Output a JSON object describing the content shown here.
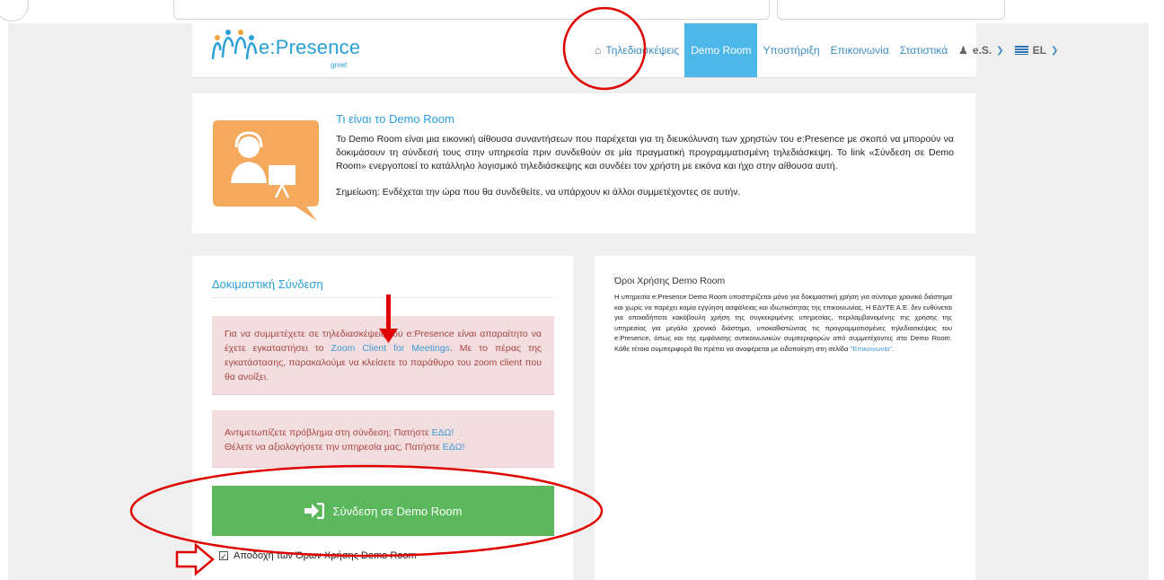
{
  "logo": {
    "text": "e:Presence",
    "sub": "grnet"
  },
  "nav": {
    "items": [
      {
        "label": "Τηλεδιασκέψεις",
        "icon": "home-icon"
      },
      {
        "label": "Demo Room",
        "active": true
      },
      {
        "label": "Υποστήριξη"
      },
      {
        "label": "Επικοινωνία"
      },
      {
        "label": "Στατιστικά"
      }
    ],
    "user_label": "e.S.",
    "lang_label": "EL"
  },
  "info": {
    "title": "Τι είναι το Demo Room",
    "text": "Το Demo Room είναι μια εικονική αίθουσα συναντήσεων που παρέχεται για τη διευκόλυνση των χρηστών του e:Presence με σκοπό να μπορούν να δοκιμάσουν τη σύνδεσή τους στην υπηρεσία πριν συνδεθούν σε μία πραγματική προγραμματισμένη τηλεδιάσκεψη. Το link «Σύνδεση σε Demo Room» ενεργοποιεί το κατάλληλο λογισμικό τηλεδιάσκεψης και συνδέει τον χρήστη με εικόνα και ήχο στην αίθουσα αυτή.",
    "note": "Σημείωση: Ενδέχεται την ώρα που θα συνδεθείτε, να υπάρχουν κι άλλοι συμμετέχοντες σε αυτήν."
  },
  "test": {
    "title": "Δοκιμαστική Σύνδεση",
    "alert1_pre": "Για να συμμετέχετε σε τηλεδιασκέψεις του e:Presence είναι απαραίτητο να έχετε εγκαταστήσει το ",
    "alert1_link": "Zoom Client for Meetings",
    "alert1_post": ". Με το πέρας της εγκατάστασης, παρακαλούμε να κλείσετε το παράθυρο του zoom client που θα ανοίξει.",
    "alert2_line1": "Αντιμετωπίζετε πρόβλημα στη σύνδεση; Πατήστε ",
    "alert2_line2": "Θέλετε να αξιολογήσετε την υπηρεσία μας; Πατήστε ",
    "here_link": "ΕΔΩ!",
    "connect_label": "Σύνδεση σε Demo Room",
    "accept_label": "Αποδοχή των Όρων Χρήσης Demo Room"
  },
  "terms": {
    "title": "Όροι Χρήσης Demo Room",
    "text": "Η υπηρεσία e:Presence Demo Room υποστηρίζεται μόνο για δοκιμαστική χρήση για σύντομο χρονικό διάστημα και χωρίς να παρέχει καμία εγγύηση ασφάλειας και ιδιωτικότητας της επικοινωνίας. Η ΕΔΥΤΕ Α.Ε. δεν ευθύνεται για οποιαδήποτε κακόβουλη χρήση της συγκεκριμένης υπηρεσίας, περιλαμβανομένης της χρήσης της υπηρεσίας για μεγάλο χρονικό διάστημα, υποκαθιστώντας τις προγραμματισμένες τηλεδιασκέψεις του e:Presence, όπως και της εμφάνισης αντικοινωνικών συμπεριφορών από συμμετέχοντες στο Demo Room. Κάθε τέτοια συμπεριφορά θα πρέπει να αναφέρεται με ειδοποίηση στη σελίδα ",
    "link": "\"Επικοινωνία\"",
    "end": "."
  },
  "colors": {
    "accent": "#4eb7ea",
    "brand": "#2a9fd8",
    "success": "#5cb85c",
    "alert_bg": "#f2dede",
    "alert_text": "#a94442",
    "annotation": "#e00000"
  }
}
